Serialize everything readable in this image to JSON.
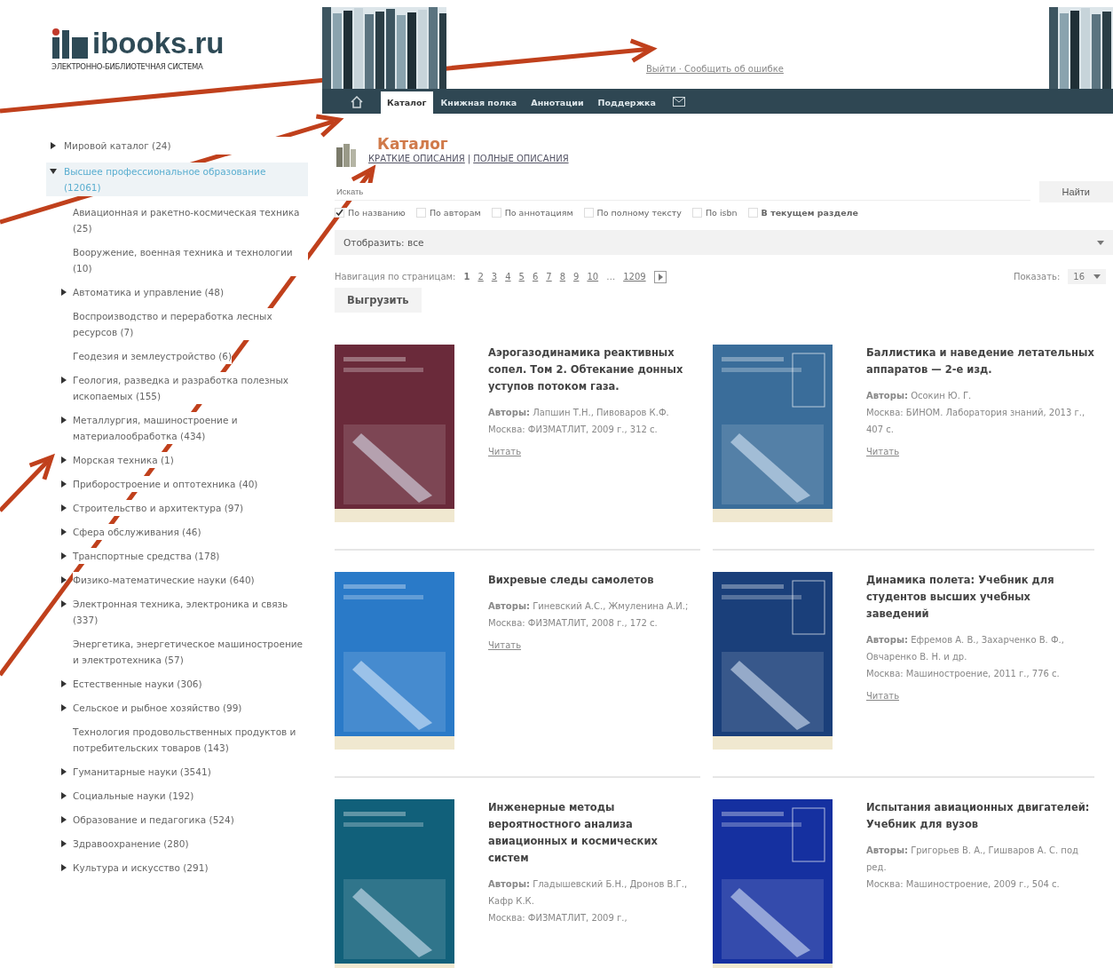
{
  "header": {
    "logo": "ibooks.ru",
    "logo_subtitle": "ЭЛЕКТРОННО-БИБЛИОТЕЧНАЯ СИСТЕМА",
    "user_links": "Выйти · Сообщить об ошибке"
  },
  "nav": {
    "tabs": [
      {
        "label": "Каталог",
        "selected": true
      },
      {
        "label": "Книжная полка",
        "selected": false
      },
      {
        "label": "Аннотации",
        "selected": false
      },
      {
        "label": "Поддержка",
        "selected": false
      }
    ]
  },
  "sidebar": {
    "items": [
      {
        "label": "Мировой каталог (24)",
        "expanded": false,
        "selected": false
      },
      {
        "label": "Высшее профессиональное образование (12061)",
        "expanded": true,
        "selected": true,
        "children": [
          {
            "label": "Авиационная и ракетно-космическая техника (25)",
            "expandable": false
          },
          {
            "label": "Вооружение, военная техника и технологии (10)",
            "expandable": false
          },
          {
            "label": "Автоматика и управление (48)",
            "expandable": true
          },
          {
            "label": "Воспроизводство и переработка лесных ресурсов (7)",
            "expandable": false
          },
          {
            "label": "Геодезия и землеустройство (6)",
            "expandable": false
          },
          {
            "label": "Геология, разведка и разработка полезных ископаемых (155)",
            "expandable": true
          },
          {
            "label": "Металлургия, машиностроение и материалообработка (434)",
            "expandable": true
          },
          {
            "label": "Морская техника (1)",
            "expandable": true
          },
          {
            "label": "Приборостроение и оптотехника (40)",
            "expandable": true
          },
          {
            "label": "Строительство и архитектура (97)",
            "expandable": true
          },
          {
            "label": "Сфера обслуживания (46)",
            "expandable": true
          },
          {
            "label": "Транспортные средства (178)",
            "expandable": true
          },
          {
            "label": "Физико-математические науки (640)",
            "expandable": true
          },
          {
            "label": "Электронная техника, электроника и связь (337)",
            "expandable": true
          },
          {
            "label": "Энергетика, энергетическое машиностроение и электротехника (57)",
            "expandable": false
          },
          {
            "label": "Естественные науки (306)",
            "expandable": true
          },
          {
            "label": "Сельское и рыбное хозяйство (99)",
            "expandable": true
          },
          {
            "label": "Технология продовольственных продуктов и потребительских товаров (143)",
            "expandable": false
          },
          {
            "label": "Гуманитарные науки (3541)",
            "expandable": true
          },
          {
            "label": "Социальные науки (192)",
            "expandable": true
          },
          {
            "label": "Образование и педагогика (524)",
            "expandable": true
          },
          {
            "label": "Здравоохранение (280)",
            "expandable": true
          },
          {
            "label": "Культура и искусство (291)",
            "expandable": true
          }
        ]
      }
    ]
  },
  "catalog": {
    "title": "Каталог",
    "view_links": [
      "КРАТКИЕ ОПИСАНИЯ",
      "ПОЛНЫЕ ОПИСАНИЯ"
    ],
    "view_separator": "|",
    "search": {
      "placeholder": "Искать",
      "button": "Найти"
    },
    "filters": [
      {
        "label": "По названию",
        "checked": true
      },
      {
        "label": "По авторам",
        "checked": false
      },
      {
        "label": "По аннотациям",
        "checked": false
      },
      {
        "label": "По полному тексту",
        "checked": false
      },
      {
        "label": "По isbn",
        "checked": false
      },
      {
        "label": "В текущем разделе",
        "checked": false
      }
    ],
    "display_select": "Отобразить: все",
    "pagination": {
      "label": "Навигация по страницам:",
      "pages": [
        {
          "label": "1",
          "selected": true
        },
        {
          "label": "2",
          "selected": false
        },
        {
          "label": "3",
          "selected": false
        },
        {
          "label": "4",
          "selected": false
        },
        {
          "label": "5",
          "selected": false
        },
        {
          "label": "6",
          "selected": false
        },
        {
          "label": "7",
          "selected": false
        },
        {
          "label": "8",
          "selected": false
        },
        {
          "label": "9",
          "selected": false
        },
        {
          "label": "10",
          "selected": false
        }
      ],
      "ellipsis": "…",
      "last": "1209"
    },
    "per_page": {
      "label": "Показать:",
      "value": "16"
    },
    "export_button": "Выгрузить",
    "books": [
      {
        "title": "Аэрогазодинамика реактивных сопел. Том 2. Обтекание донных уступов потоком газа.",
        "authors_label": "Авторы:",
        "authors": "Лапшин Т.Н., Пивоваров К.Ф.",
        "publisher": "Москва: ФИЗМАТЛИТ, 2009 г., 312 с.",
        "read": "Читать"
      },
      {
        "title": "Баллистика и наведение летательных аппаратов — 2-е изд.",
        "authors_label": "Авторы:",
        "authors": "Осокин Ю. Г.",
        "publisher": "Москва: БИНОМ. Лаборатория знаний, 2013 г., 407 с.",
        "read": "Читать"
      },
      {
        "title": "Вихревые следы самолетов",
        "authors_label": "Авторы:",
        "authors": "Гиневский А.С., Жмуленина А.И.;",
        "publisher": "Москва: ФИЗМАТЛИТ, 2008 г., 172 с.",
        "read": "Читать"
      },
      {
        "title": "Динамика полета: Учебник для студентов высших учебных заведений",
        "authors_label": "Авторы:",
        "authors": "Ефремов А. В., Захарченко В. Ф., Овчаренко В. Н. и др.",
        "publisher": "Москва: Машиностроение, 2011 г., 776 с.",
        "read": "Читать"
      },
      {
        "title": "Инженерные методы вероятностного анализа авиационных и космических систем",
        "authors_label": "Авторы:",
        "authors": "Гладышевский Б.Н., Дронов В.Г., Кафр К.К.",
        "publisher": "Москва: ФИЗМАТЛИТ, 2009 г.,"
      },
      {
        "title": "Испытания авиационных двигателей: Учебник для вузов",
        "authors_label": "Авторы:",
        "authors": "Григорьев В. А., Гишваров А. С. под ред.",
        "publisher": "Москва: Машиностроение, 2009 г., 504 с."
      }
    ]
  }
}
